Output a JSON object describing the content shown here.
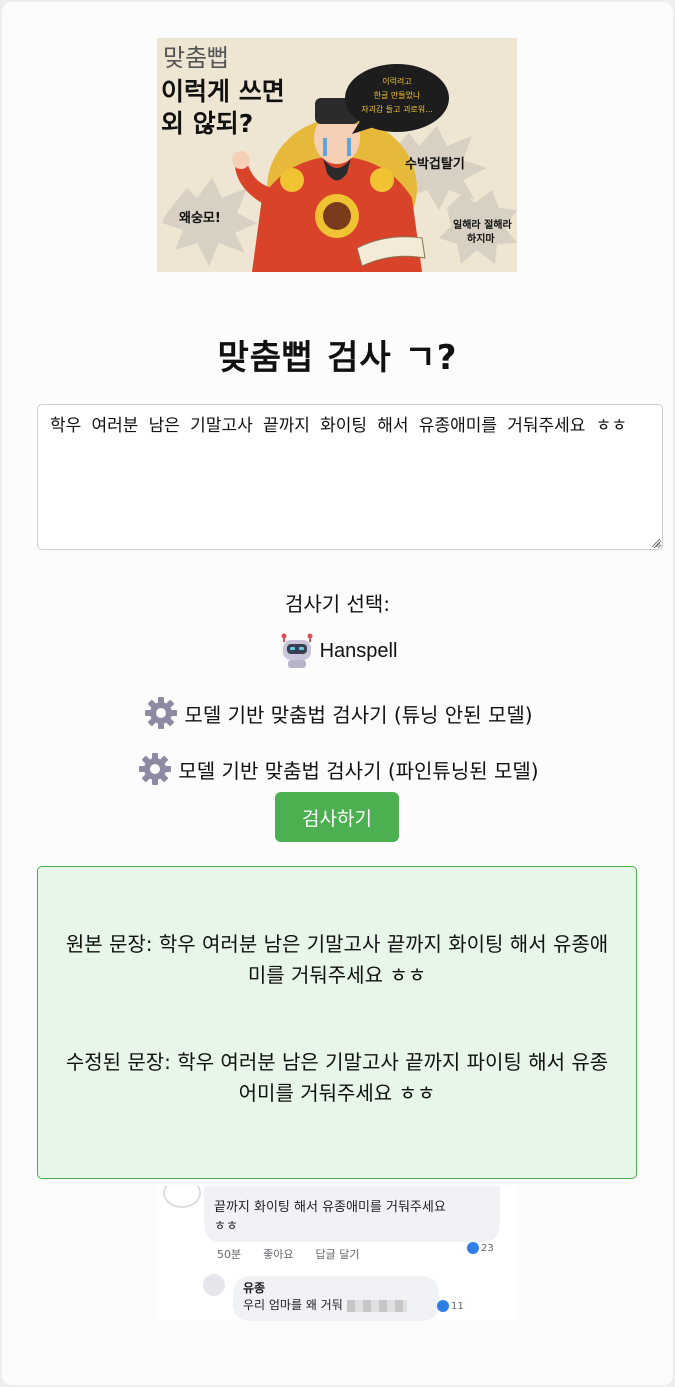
{
  "hero": {
    "small_title": "맞춤뻡",
    "headline_line1": "이럭게 쓰면",
    "headline_line2": "외 않되?",
    "speech": [
      "이럭려고",
      "한글 만들었나",
      "자괴감 들고 괴로워..."
    ],
    "burst_left": "왜숭모!",
    "burst_right": "수박겁탈기",
    "burst_bottom_line1": "일해라 절해라",
    "burst_bottom_line2": "하지마"
  },
  "page": {
    "title": "맞춤뻡 검사 ㄱ?"
  },
  "input": {
    "value": "학우 여러분 남은 기말고사 끝까지 화이팅 해서 유종애미를 거둬주세요 ㅎㅎ"
  },
  "checker": {
    "label": "검사기 선택:",
    "options": [
      {
        "icon": "robot-icon",
        "label": "Hanspell"
      },
      {
        "icon": "gear-icon",
        "label": "모델 기반 맞춤법 검사기 (튜닝 안된 모델)"
      },
      {
        "icon": "gear-icon",
        "label": "모델 기반 맞춤법 검사기 (파인튜닝된 모델)"
      }
    ],
    "submit_label": "검사하기"
  },
  "result": {
    "original": "원본 문장: 학우 여러분 남은 기말고사 끝까지 화이팅 해서 유종애미를 거둬주세요 ㅎㅎ",
    "corrected": "수정된 문장: 학우 여러분 남은 기말고사 끝까지 파이팅 해서 유종 어미를 거둬주세요 ㅎㅎ"
  },
  "comment_image": {
    "comment_line1": "끝까지 화이팅 해서 유종애미를 거둬주세요",
    "comment_line2": "ㅎㅎ",
    "time": "50분",
    "like": "좋아요",
    "reply": "답글 달기",
    "like_count": "23",
    "reply_author": "유종",
    "reply_text": "우리 엄마를 왜 거둬",
    "reply_like_count": "11"
  },
  "colors": {
    "submit_button": "#4caf50",
    "result_bg": "#e8f5e9",
    "result_border": "#4caf50",
    "hero_robe": "#d9432a"
  }
}
